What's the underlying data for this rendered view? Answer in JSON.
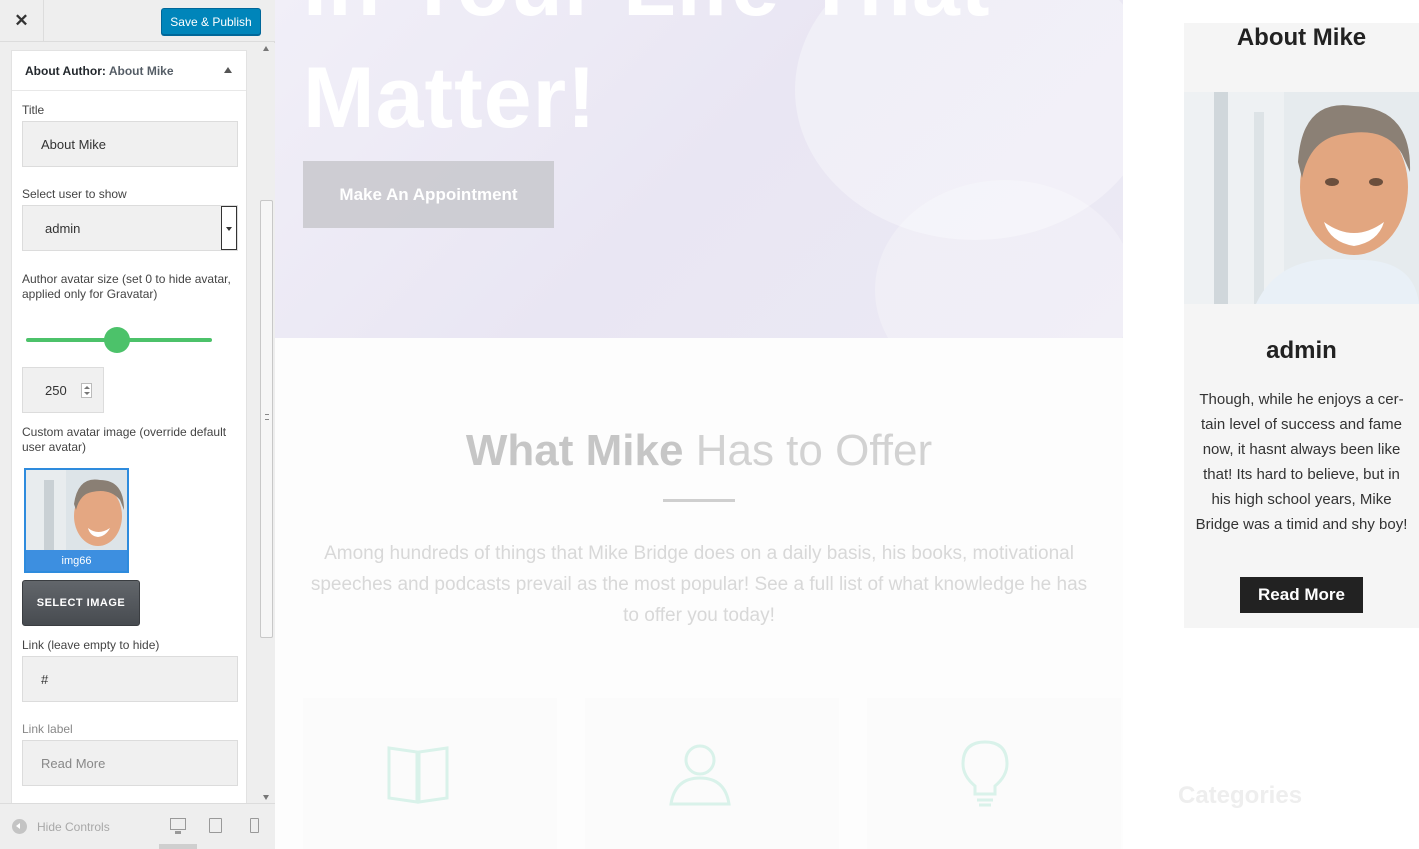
{
  "customizer": {
    "close_symbol": "✕",
    "save_label": "Save & Publish",
    "widget": {
      "title_prefix": "About Author:",
      "title_name": "About Mike",
      "fields": {
        "title_label": "Title",
        "title_value": "About Mike",
        "user_label": "Select user to show",
        "user_value": "admin",
        "avatar_size_label": "Author avatar size (set 0 to hide avatar, applied only for Gravatar)",
        "avatar_size_value": "250",
        "avatar_size_slider_fraction": 0.5,
        "custom_avatar_label": "Custom avatar image (override default user avatar)",
        "image_name": "img66",
        "select_image_label": "SELECT IMAGE",
        "link_label": "Link (leave empty to hide)",
        "link_value": "#",
        "link_label_label": "Link label",
        "link_label_value": "Read More"
      }
    },
    "footer": {
      "hide_controls_label": "Hide Controls"
    }
  },
  "preview": {
    "hero": {
      "title_line1": "In Your Life That",
      "title_line2": "Matter!",
      "button_label": "Make An Appointment"
    },
    "offer": {
      "title_bold": "What Mike",
      "title_rest": "Has to Offer",
      "text": "Among hundreds of things that Mike Bridge does on a daily basis, his books, motivational speeches and podcasts prevail as the most popular! See a full list of what knowledge he has to offer you today!"
    },
    "about": {
      "title": "About Mike",
      "name": "admin",
      "text": "Though, while he enjoys a cer-tain level of success and fame now, it hasnt always been like that! Its hard to believe, but in his high school years, Mike Bridge was a timid and shy boy!",
      "button_label": "Read More"
    },
    "categories_title": "Categories"
  },
  "colors": {
    "primary_button": "#0085ba",
    "slider": "#4cc26a",
    "selected_image_border": "#2e8bdd"
  }
}
